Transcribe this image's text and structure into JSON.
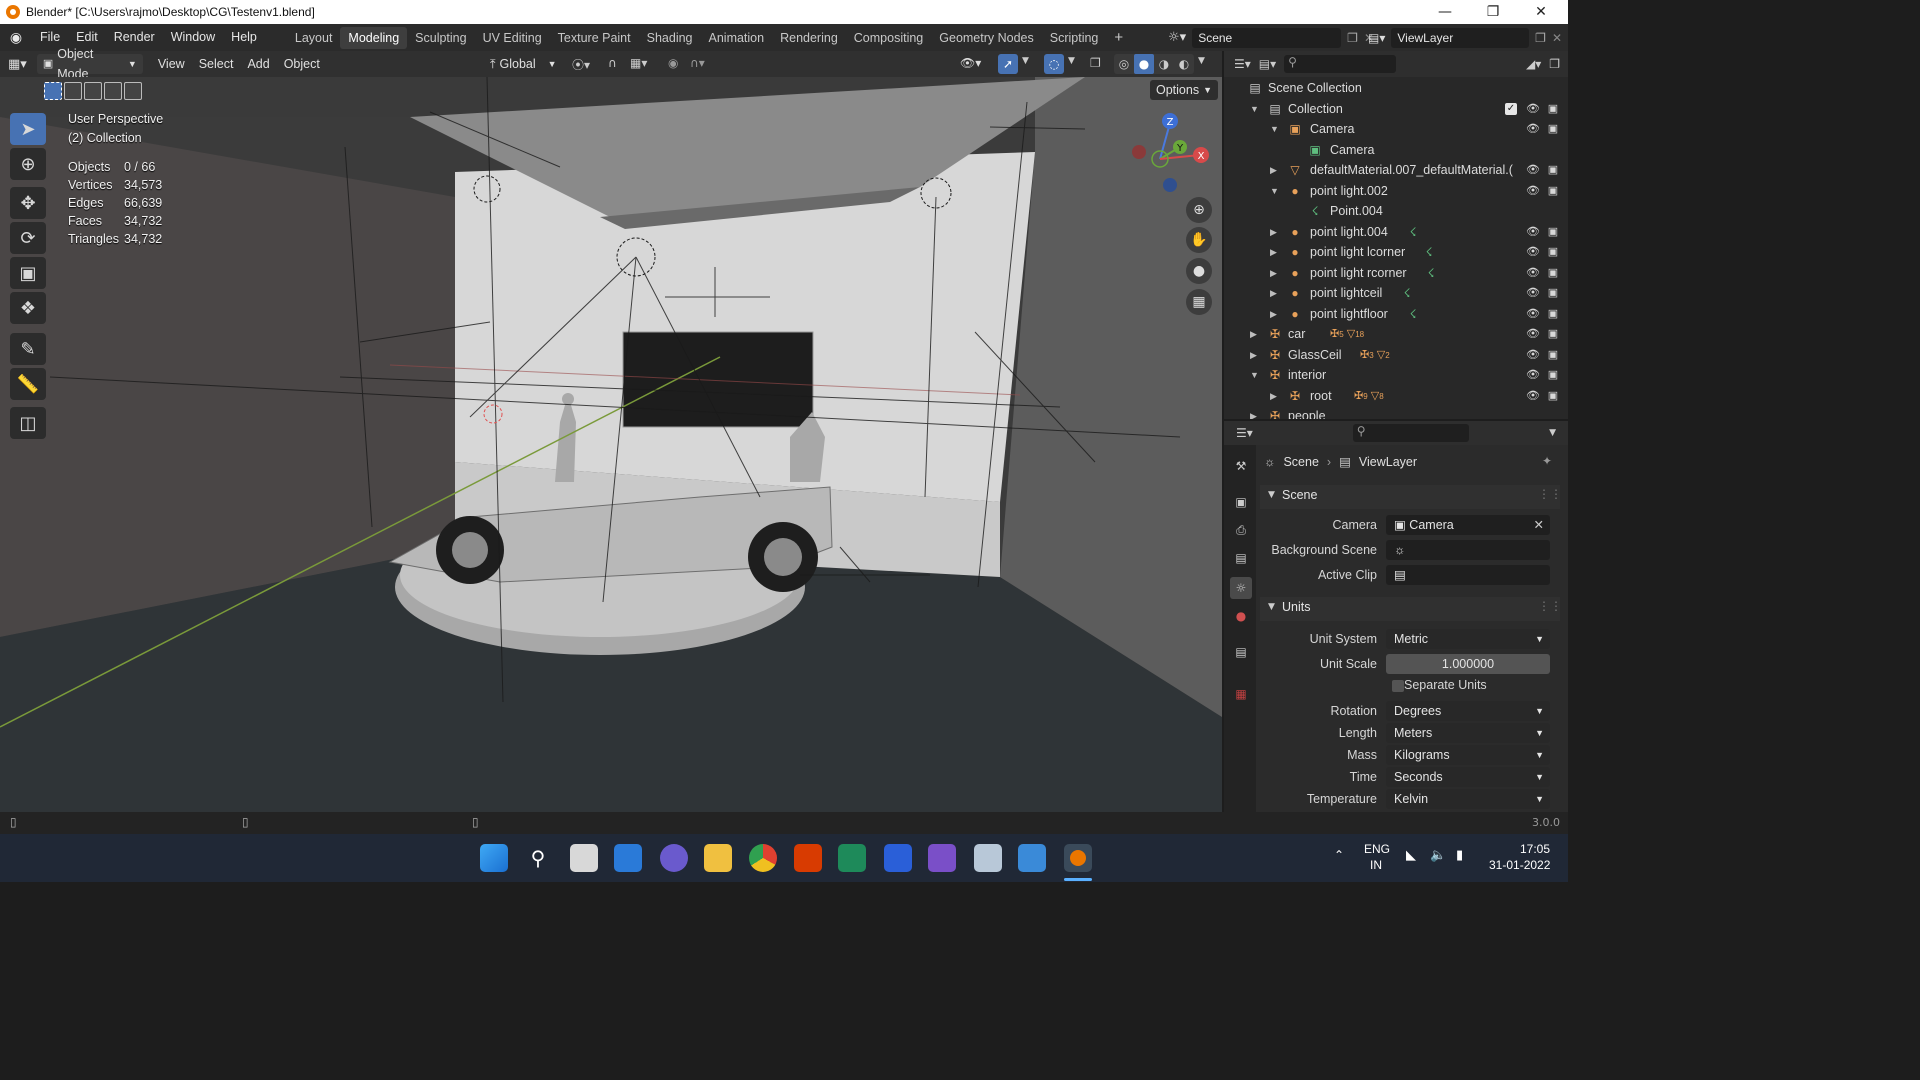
{
  "window": {
    "title": "Blender* [C:\\Users\\rajmo\\Desktop\\CG\\Testenv1.blend]"
  },
  "menu": [
    "File",
    "Edit",
    "Render",
    "Window",
    "Help"
  ],
  "workspaces": [
    "Layout",
    "Modeling",
    "Sculpting",
    "UV Editing",
    "Texture Paint",
    "Shading",
    "Animation",
    "Rendering",
    "Compositing",
    "Geometry Nodes",
    "Scripting"
  ],
  "active_workspace": "Modeling",
  "top_right": {
    "scene": "Scene",
    "view_layer": "ViewLayer"
  },
  "viewport_header": {
    "mode": "Object Mode",
    "menus": [
      "View",
      "Select",
      "Add",
      "Object"
    ],
    "transform_orientation": "Global",
    "options": "Options"
  },
  "overlay_info": {
    "view": "User Perspective",
    "collection": "(2) Collection",
    "stats": [
      {
        "label": "Objects",
        "value": "0 / 66"
      },
      {
        "label": "Vertices",
        "value": "34,573"
      },
      {
        "label": "Edges",
        "value": "66,639"
      },
      {
        "label": "Faces",
        "value": "34,732"
      },
      {
        "label": "Triangles",
        "value": "34,732"
      }
    ]
  },
  "gizmo": {
    "z": "Z",
    "y": "Y",
    "x": "X"
  },
  "outliner": {
    "root": "Scene Collection",
    "rows": [
      {
        "label": "Collection",
        "icon": "collection-icon",
        "color": "#d8d8d8"
      },
      {
        "label": "Camera",
        "icon": "camera-object-icon",
        "color": "#e8a15a"
      },
      {
        "label": "Camera",
        "icon": "camera-data-icon",
        "color": "#5fbf7f"
      },
      {
        "label": "defaultMaterial.007_defaultMaterial.(",
        "icon": "mesh-icon",
        "color": "#e8a15a"
      },
      {
        "label": "point light.002",
        "icon": "light-icon",
        "color": "#e8a15a"
      },
      {
        "label": "Point.004",
        "icon": "light-data-icon",
        "color": "#5fbf7f"
      },
      {
        "label": "point light.004",
        "icon": "light-icon",
        "color": "#e8a15a"
      },
      {
        "label": "point light lcorner",
        "icon": "light-icon",
        "color": "#e8a15a"
      },
      {
        "label": "point light rcorner",
        "icon": "light-icon",
        "color": "#e8a15a"
      },
      {
        "label": "point lightceil",
        "icon": "light-icon",
        "color": "#e8a15a"
      },
      {
        "label": "point lightfloor",
        "icon": "light-icon",
        "color": "#e8a15a"
      },
      {
        "label": "car",
        "icon": "empty-icon",
        "color": "#e8a15a",
        "badges": [
          "5",
          "18"
        ]
      },
      {
        "label": "GlassCeil",
        "icon": "empty-icon",
        "color": "#e8a15a",
        "badges": [
          "3",
          "2"
        ]
      },
      {
        "label": "interior",
        "icon": "empty-icon",
        "color": "#e8a15a"
      },
      {
        "label": "root",
        "icon": "empty-icon",
        "color": "#e8a15a",
        "badges": [
          "9",
          "8"
        ]
      },
      {
        "label": "people",
        "icon": "empty-icon",
        "color": "#e8a15a"
      }
    ]
  },
  "properties": {
    "breadcrumb": [
      "Scene",
      "ViewLayer"
    ],
    "scene_panel": {
      "title": "Scene",
      "camera_label": "Camera",
      "camera_value": "Camera",
      "background_label": "Background Scene",
      "clip_label": "Active Clip"
    },
    "units_panel": {
      "title": "Units",
      "fields": [
        {
          "label": "Unit System",
          "value": "Metric"
        },
        {
          "label": "Unit Scale",
          "value": "1.000000"
        },
        {
          "label": "Rotation",
          "value": "Degrees"
        },
        {
          "label": "Length",
          "value": "Meters"
        },
        {
          "label": "Mass",
          "value": "Kilograms"
        },
        {
          "label": "Time",
          "value": "Seconds"
        },
        {
          "label": "Temperature",
          "value": "Kelvin"
        }
      ],
      "separate_units": "Separate Units"
    }
  },
  "statusbar": {
    "version": "3.0.0"
  },
  "taskbar": {
    "lang1": "ENG",
    "lang2": "IN",
    "time": "17:05",
    "date": "31-01-2022"
  },
  "colors": {
    "accent": "#4772b3",
    "header": "#303030",
    "viewport": "#3b3b3b"
  }
}
